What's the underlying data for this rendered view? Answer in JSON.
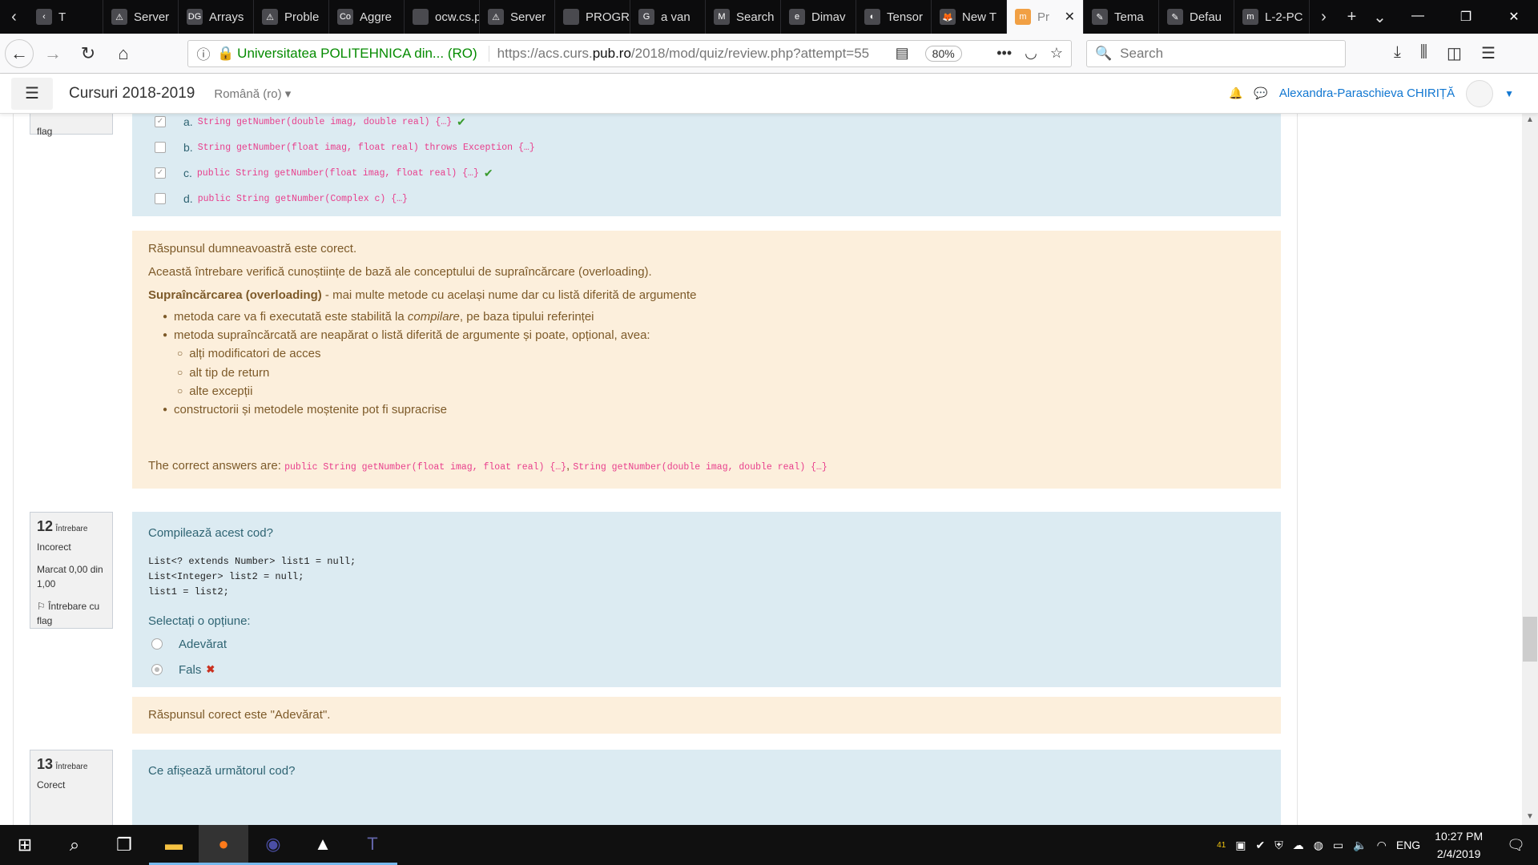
{
  "browser": {
    "tabs": [
      {
        "label": "T",
        "icon": "‹"
      },
      {
        "label": "Server",
        "icon": "⚠"
      },
      {
        "label": "Arrays",
        "icon": "DG"
      },
      {
        "label": "Proble",
        "icon": "⚠"
      },
      {
        "label": "Aggre",
        "icon": "Co"
      },
      {
        "label": "ocw.cs.pub",
        "icon": ""
      },
      {
        "label": "Server",
        "icon": "⚠"
      },
      {
        "label": "PROGRAM",
        "icon": ""
      },
      {
        "label": "a van",
        "icon": "G"
      },
      {
        "label": "Search",
        "icon": "M"
      },
      {
        "label": "Dimav",
        "icon": "e"
      },
      {
        "label": "Tensor",
        "icon": "◐"
      },
      {
        "label": "New T",
        "icon": "🦊"
      },
      {
        "label": "Pr",
        "icon": "m"
      },
      {
        "label": "Tema",
        "icon": "✎"
      },
      {
        "label": "Defau",
        "icon": "✎"
      },
      {
        "label": "L-2-PC",
        "icon": "m"
      }
    ],
    "active_tab_index": 13,
    "url_org": "Universitatea POLITEHNICA din... (RO)",
    "url_prefix": "https://acs.curs.",
    "url_domain": "pub.ro",
    "url_suffix": "/2018/mod/quiz/review.php?attempt=55",
    "zoom": "80%",
    "search_placeholder": "Search"
  },
  "header": {
    "site_name": "Cursuri 2018-2019",
    "language": "Română (ro)",
    "user_name": "Alexandra-Paraschieva CHIRIȚĂ"
  },
  "q11": {
    "flag_text": "flag",
    "options": [
      {
        "letter": "a.",
        "code": "String getNumber(double imag, double real) {…}",
        "checked": true,
        "correct": true
      },
      {
        "letter": "b.",
        "code": "String getNumber(float imag, float real) throws Exception {…}",
        "checked": false,
        "correct": false
      },
      {
        "letter": "c.",
        "code": "public String getNumber(float imag, float real) {…}",
        "checked": true,
        "correct": true
      },
      {
        "letter": "d.",
        "code": "public String getNumber(Complex c) {…}",
        "checked": false,
        "correct": false
      }
    ],
    "feedback": {
      "result": "Răspunsul dumneavoastră este corect.",
      "intro": "Această întrebare verifică cunoștiințe de bază ale conceptului de supraîncărcare (overloading).",
      "def_bold": "Supraîncărcarea (overloading)",
      "def_rest": " - mai multe metode cu același nume dar cu listă diferită de argumente",
      "b1_pre": "metoda care va fi executată este stabilită la ",
      "b1_em": "compilare",
      "b1_post": ", pe baza tipului referinței",
      "b2": "metoda supraîncărcată are neapărat o listă diferită de argumente și poate, opțional, avea:",
      "sub1": "alți modificatori de acces",
      "sub2": "alt tip de return",
      "sub3": "alte excepții",
      "b3": "constructorii și metodele moștenite pot fi supracrise",
      "answers_label": "The correct answers are: ",
      "answer1": "public String getNumber(float imag, float real) {…}",
      "sep": ", ",
      "answer2": "String getNumber(double imag, double real) {…}"
    }
  },
  "q12": {
    "number": "12",
    "label": "Întrebare",
    "state": "Incorect",
    "mark": "Marcat 0,00 din 1,00",
    "flag": "Întrebare cu flag",
    "question": "Compilează acest cod?",
    "code_lines": [
      "List<? extends Number> list1 = null;",
      "List<Integer> list2 = null;",
      "list1 = list2;"
    ],
    "prompt": "Selectați o opțiune:",
    "options": [
      {
        "label": "Adevărat",
        "selected": false
      },
      {
        "label": "Fals",
        "selected": true
      }
    ],
    "feedback": "Răspunsul corect este \"Adevărat\"."
  },
  "q13": {
    "number": "13",
    "label": "Întrebare",
    "state": "Corect",
    "question": "Ce afișează următorul cod?"
  },
  "taskbar": {
    "tray_num": "41",
    "lang": "ENG",
    "time": "10:27 PM",
    "date": "2/4/2019"
  }
}
